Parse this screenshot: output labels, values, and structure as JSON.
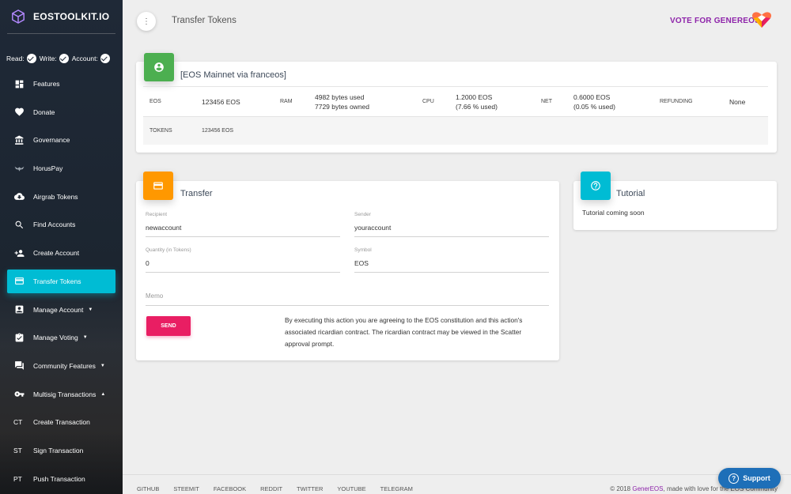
{
  "sidebar": {
    "brand": "EOSTOOLKIT.IO",
    "permissions": [
      {
        "label": "Read:"
      },
      {
        "label": "Write:"
      },
      {
        "label": "Account:"
      }
    ],
    "items": [
      {
        "label": "Features",
        "icon": "dashboard-icon"
      },
      {
        "label": "Donate",
        "icon": "heart-icon"
      },
      {
        "label": "Governance",
        "icon": "bank-icon"
      },
      {
        "label": "HorusPay",
        "icon": "horus-icon"
      },
      {
        "label": "Airgrab Tokens",
        "icon": "cloud-download-icon"
      },
      {
        "label": "Find Accounts",
        "icon": "search-icon"
      },
      {
        "label": "Create Account",
        "icon": "person-add-icon"
      },
      {
        "label": "Transfer Tokens",
        "icon": "credit-card-icon",
        "active": true
      },
      {
        "label": "Manage Account",
        "icon": "account-box-icon",
        "caret": "▼"
      },
      {
        "label": "Manage Voting",
        "icon": "assignment-check-icon",
        "caret": "▼"
      },
      {
        "label": "Community Features",
        "icon": "forum-icon",
        "caret": "▼"
      },
      {
        "label": "Multisig Transactions",
        "icon": "key-icon",
        "caret": "▲"
      },
      {
        "label": "Create Transaction",
        "abbr": "CT"
      },
      {
        "label": "Sign Transaction",
        "abbr": "ST"
      },
      {
        "label": "Push Transaction",
        "abbr": "PT"
      }
    ]
  },
  "header": {
    "menu_glyph": "⋮",
    "title": "Transfer Tokens",
    "vote": "VOTE FOR GENEREOS"
  },
  "account_card": {
    "title": "[EOS Mainnet via franceos]",
    "eos_label": "EOS",
    "eos_value": "123456 EOS",
    "ram_label": "RAM",
    "ram_used": "4982 bytes used",
    "ram_owned": "7729 bytes owned",
    "cpu_label": "CPU",
    "cpu_value": "1.2000 EOS",
    "cpu_pct": "(7.66 % used)",
    "net_label": "NET",
    "net_value": "0.6000 EOS",
    "net_pct": "(0.05 % used)",
    "refunding_label": "REFUNDING",
    "refunding_value": "None",
    "tokens_label": "TOKENS",
    "tokens_value": "123456 EOS"
  },
  "transfer": {
    "title": "Transfer",
    "recipient_label": "Recipient",
    "recipient_value": "newaccount",
    "sender_label": "Sender",
    "sender_value": "youraccount",
    "quantity_label": "Quantity (in Tokens)",
    "quantity_value": "0",
    "symbol_label": "Symbol",
    "symbol_value": "EOS",
    "memo_placeholder": "Memo",
    "send_label": "SEND",
    "terms": "By executing this action you are agreeing to the EOS constitution and this action's associated ricardian contract. The ricardian contract may be viewed in the Scatter approval prompt."
  },
  "tutorial": {
    "title": "Tutorial",
    "text": "Tutorial coming soon"
  },
  "footer": {
    "links": [
      "GITHUB",
      "STEEMIT",
      "FACEBOOK",
      "REDDIT",
      "TWITTER",
      "YOUTUBE",
      "TELEGRAM"
    ],
    "copyright_prefix": "© 2018",
    "copyright_brand": "GenerEOS",
    "copyright_suffix": ", made with love for the EOS Community"
  },
  "support": {
    "label": "Support",
    "glyph": "?"
  },
  "colors": {
    "sidebar_active": "#00bcd4",
    "brand_purple": "#8e24aa",
    "account_icon_bg": "#4caf50",
    "transfer_icon_bg": "#ff9800",
    "tutorial_icon_bg": "#00bcd4",
    "send_button": "#e91e63",
    "support_button": "#1e6fb8"
  }
}
